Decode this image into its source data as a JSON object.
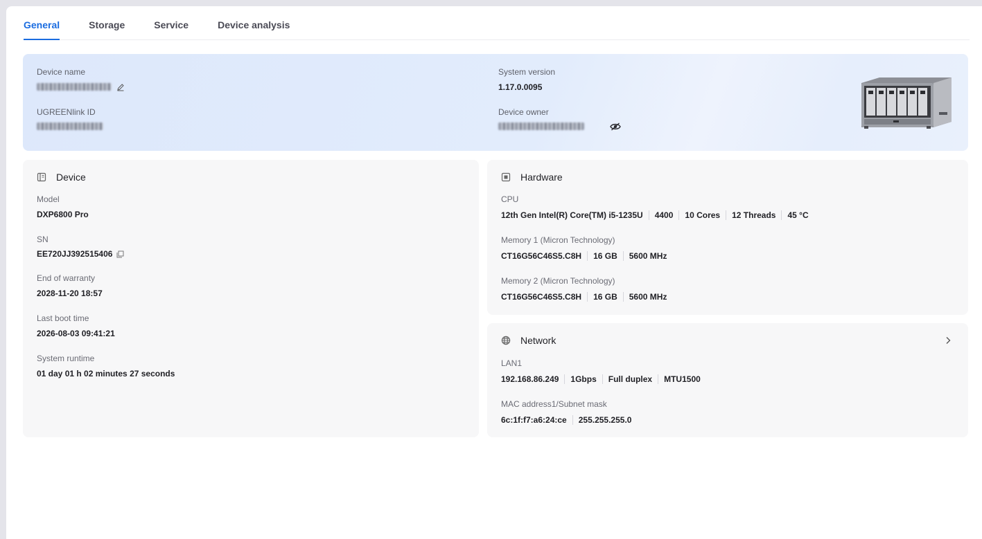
{
  "tabs": [
    {
      "label": "General",
      "active": true
    },
    {
      "label": "Storage",
      "active": false
    },
    {
      "label": "Service",
      "active": false
    },
    {
      "label": "Device analysis",
      "active": false
    }
  ],
  "banner": {
    "device_name_label": "Device name",
    "ugreenlink_label": "UGREENlink ID",
    "system_version_label": "System version",
    "system_version": "1.17.0.0095",
    "device_owner_label": "Device owner"
  },
  "device": {
    "title": "Device",
    "model_label": "Model",
    "model": "DXP6800 Pro",
    "sn_label": "SN",
    "sn": "EE720JJ392515406",
    "warranty_label": "End of warranty",
    "warranty": "2028-11-20 18:57",
    "boot_label": "Last boot time",
    "boot": "2026-08-03 09:41:21",
    "runtime_label": "System runtime",
    "runtime": "01 day 01 h 02 minutes 27 seconds"
  },
  "hardware": {
    "title": "Hardware",
    "cpu_label": "CPU",
    "cpu": [
      "12th Gen Intel(R) Core(TM) i5-1235U",
      "4400",
      "10 Cores",
      "12 Threads",
      "45 °C"
    ],
    "mem1_label": "Memory 1 (Micron Technology)",
    "mem1": [
      "CT16G56C46S5.C8H",
      "16 GB",
      "5600 MHz"
    ],
    "mem2_label": "Memory 2 (Micron Technology)",
    "mem2": [
      "CT16G56C46S5.C8H",
      "16 GB",
      "5600 MHz"
    ]
  },
  "network": {
    "title": "Network",
    "lan_label": "LAN1",
    "lan": [
      "192.168.86.249",
      "1Gbps",
      "Full duplex",
      "MTU1500"
    ],
    "mac_label": "MAC address1/Subnet mask",
    "mac": [
      "6c:1f:f7:a6:24:ce",
      "255.255.255.0"
    ]
  },
  "colors": {
    "accent": "#1a6ce0",
    "banner": "#dde8fb",
    "card": "#f7f7f8"
  },
  "icons": [
    "edit-icon",
    "hide-password-icon",
    "device-icon",
    "chip-icon",
    "globe-icon",
    "chevron-right-icon",
    "copy-icon"
  ]
}
